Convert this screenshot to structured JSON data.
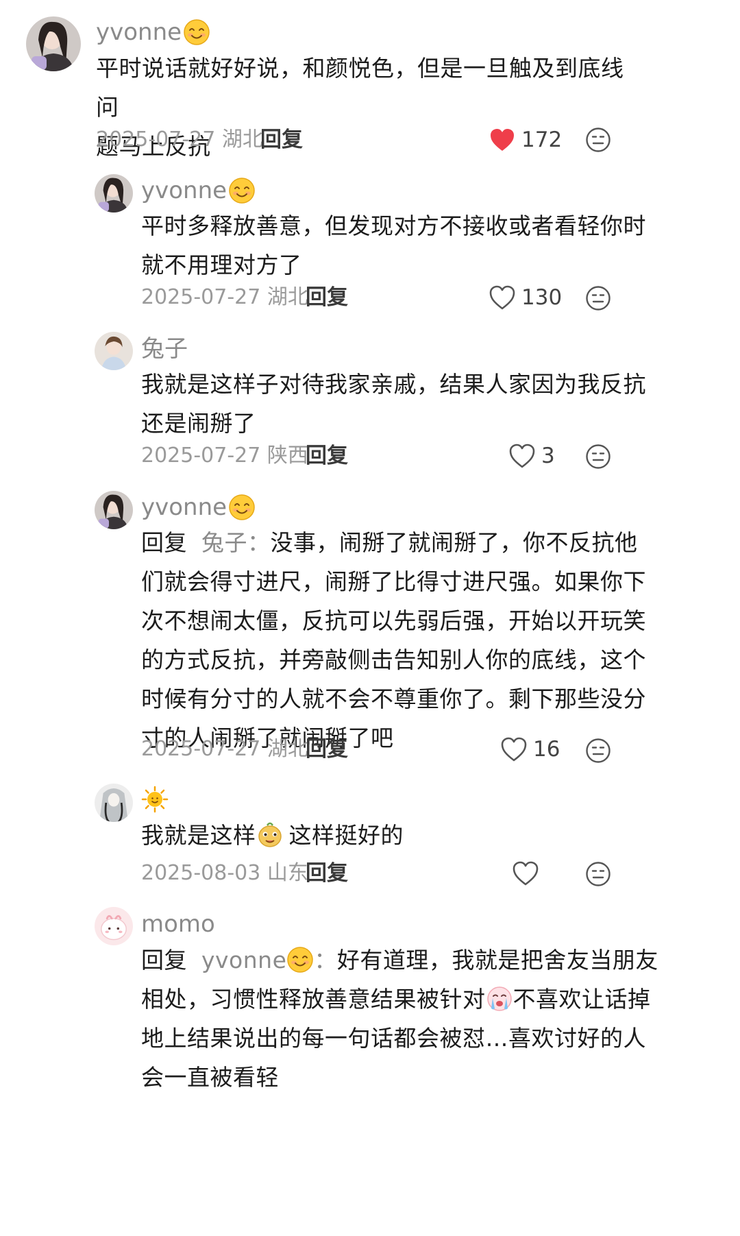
{
  "colors": {
    "liked_heart": "#ef3e4a",
    "meta_gray": "#9a9a9a",
    "text": "#1c1c1c"
  },
  "comments": [
    {
      "author": "yvonne",
      "author_emoji": "smile-emoji",
      "text_lines": [
        "平时说话就好好说，和颜悦色，但是一旦触及到底线问",
        "题马上反抗"
      ],
      "date": "2025-07-27",
      "location": "湖北",
      "reply_label": "回复",
      "likes": "172",
      "liked": true
    },
    {
      "author": "yvonne",
      "author_emoji": "smile-emoji",
      "text_lines": [
        "平时多释放善意，但发现对方不接收或者看轻你时",
        "就不用理对方了"
      ],
      "date": "2025-07-27",
      "location": "湖北",
      "reply_label": "回复",
      "likes": "130",
      "liked": false
    },
    {
      "author": "兔子",
      "text_lines": [
        "我就是这样子对待我家亲戚，结果人家因为我反抗",
        "还是闹掰了"
      ],
      "date": "2025-07-27",
      "location": "陕西",
      "reply_label": "回复",
      "likes": "3",
      "liked": false
    },
    {
      "author": "yvonne",
      "author_emoji": "smile-emoji",
      "reply_prefix": "回复",
      "reply_to": "兔子",
      "reply_colon": "：",
      "first_line_rest": "没事，闹掰了就闹掰了，你不反抗他",
      "text_lines": [
        "们就会得寸进尺，闹掰了比得寸进尺强。如果你下",
        "次不想闹太僵，反抗可以先弱后强，开始以开玩笑",
        "的方式反抗，并旁敲侧击告知别人你的底线，这个",
        "时候有分寸的人就不会不尊重你了。剩下那些没分",
        "寸的人闹掰了就闹掰了吧"
      ],
      "date": "2025-07-27",
      "location": "湖北",
      "reply_label": "回复",
      "likes": "16",
      "liked": false
    },
    {
      "author_emoji": "sun-emoji",
      "text_before": "我就是这样",
      "text_emoji": "cheeky-face-emoji",
      "text_after": "这样挺好的",
      "date": "2025-08-03",
      "location": "山东",
      "reply_label": "回复",
      "likes": "",
      "liked": false
    },
    {
      "author": "momo",
      "reply_prefix": "回复",
      "reply_to": "yvonne",
      "reply_to_emoji": "smile-emoji",
      "reply_colon": "：",
      "first_line_rest": "好有道理，我就是把舍友当朋友",
      "line2_before": "相处，习惯性释放善意结果被针对",
      "line2_emoji": "crying-face-emoji",
      "line2_after": "不喜欢让话掉",
      "text_lines": [
        "地上结果说出的每一句话都会被怼…喜欢讨好的人",
        "会一直被看轻"
      ]
    }
  ]
}
